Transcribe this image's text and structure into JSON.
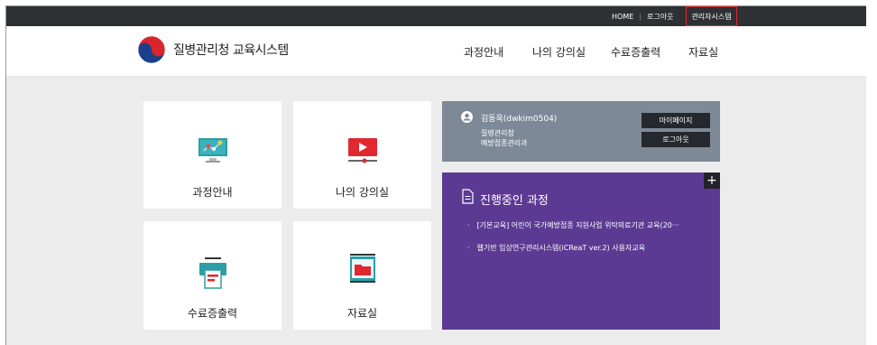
{
  "util": {
    "home": "HOME",
    "logout": "로그아웃",
    "admin": "관리자시스템"
  },
  "brand": {
    "title": "질병관리청 교육시스템"
  },
  "nav": [
    "과정안내",
    "나의 강의실",
    "수료증출력",
    "자료실"
  ],
  "tiles": {
    "course": "과정안내",
    "classroom": "나의 강의실",
    "certificate": "수료증출력",
    "library": "자료실"
  },
  "user": {
    "name": "김동욱(dwkim0504)",
    "org_line1": "질병관리청",
    "org_line2": "예방접종관리과",
    "mypage_label": "마이페이지",
    "logout_label": "로그아웃"
  },
  "courses": {
    "title": "진행중인 과정",
    "plus": "+",
    "items": [
      "[기본교육] 어린이 국가예방접종 지원사업 위탁의료기관 교육(20···",
      "웹기반 임상연구관리시스템(iCReaT ver.2) 사용자교육"
    ]
  },
  "colors": {
    "topbar": "#2e3034",
    "admin_border": "#e0272c",
    "user_panel": "#7e8997",
    "course_panel": "#5c3a93"
  }
}
